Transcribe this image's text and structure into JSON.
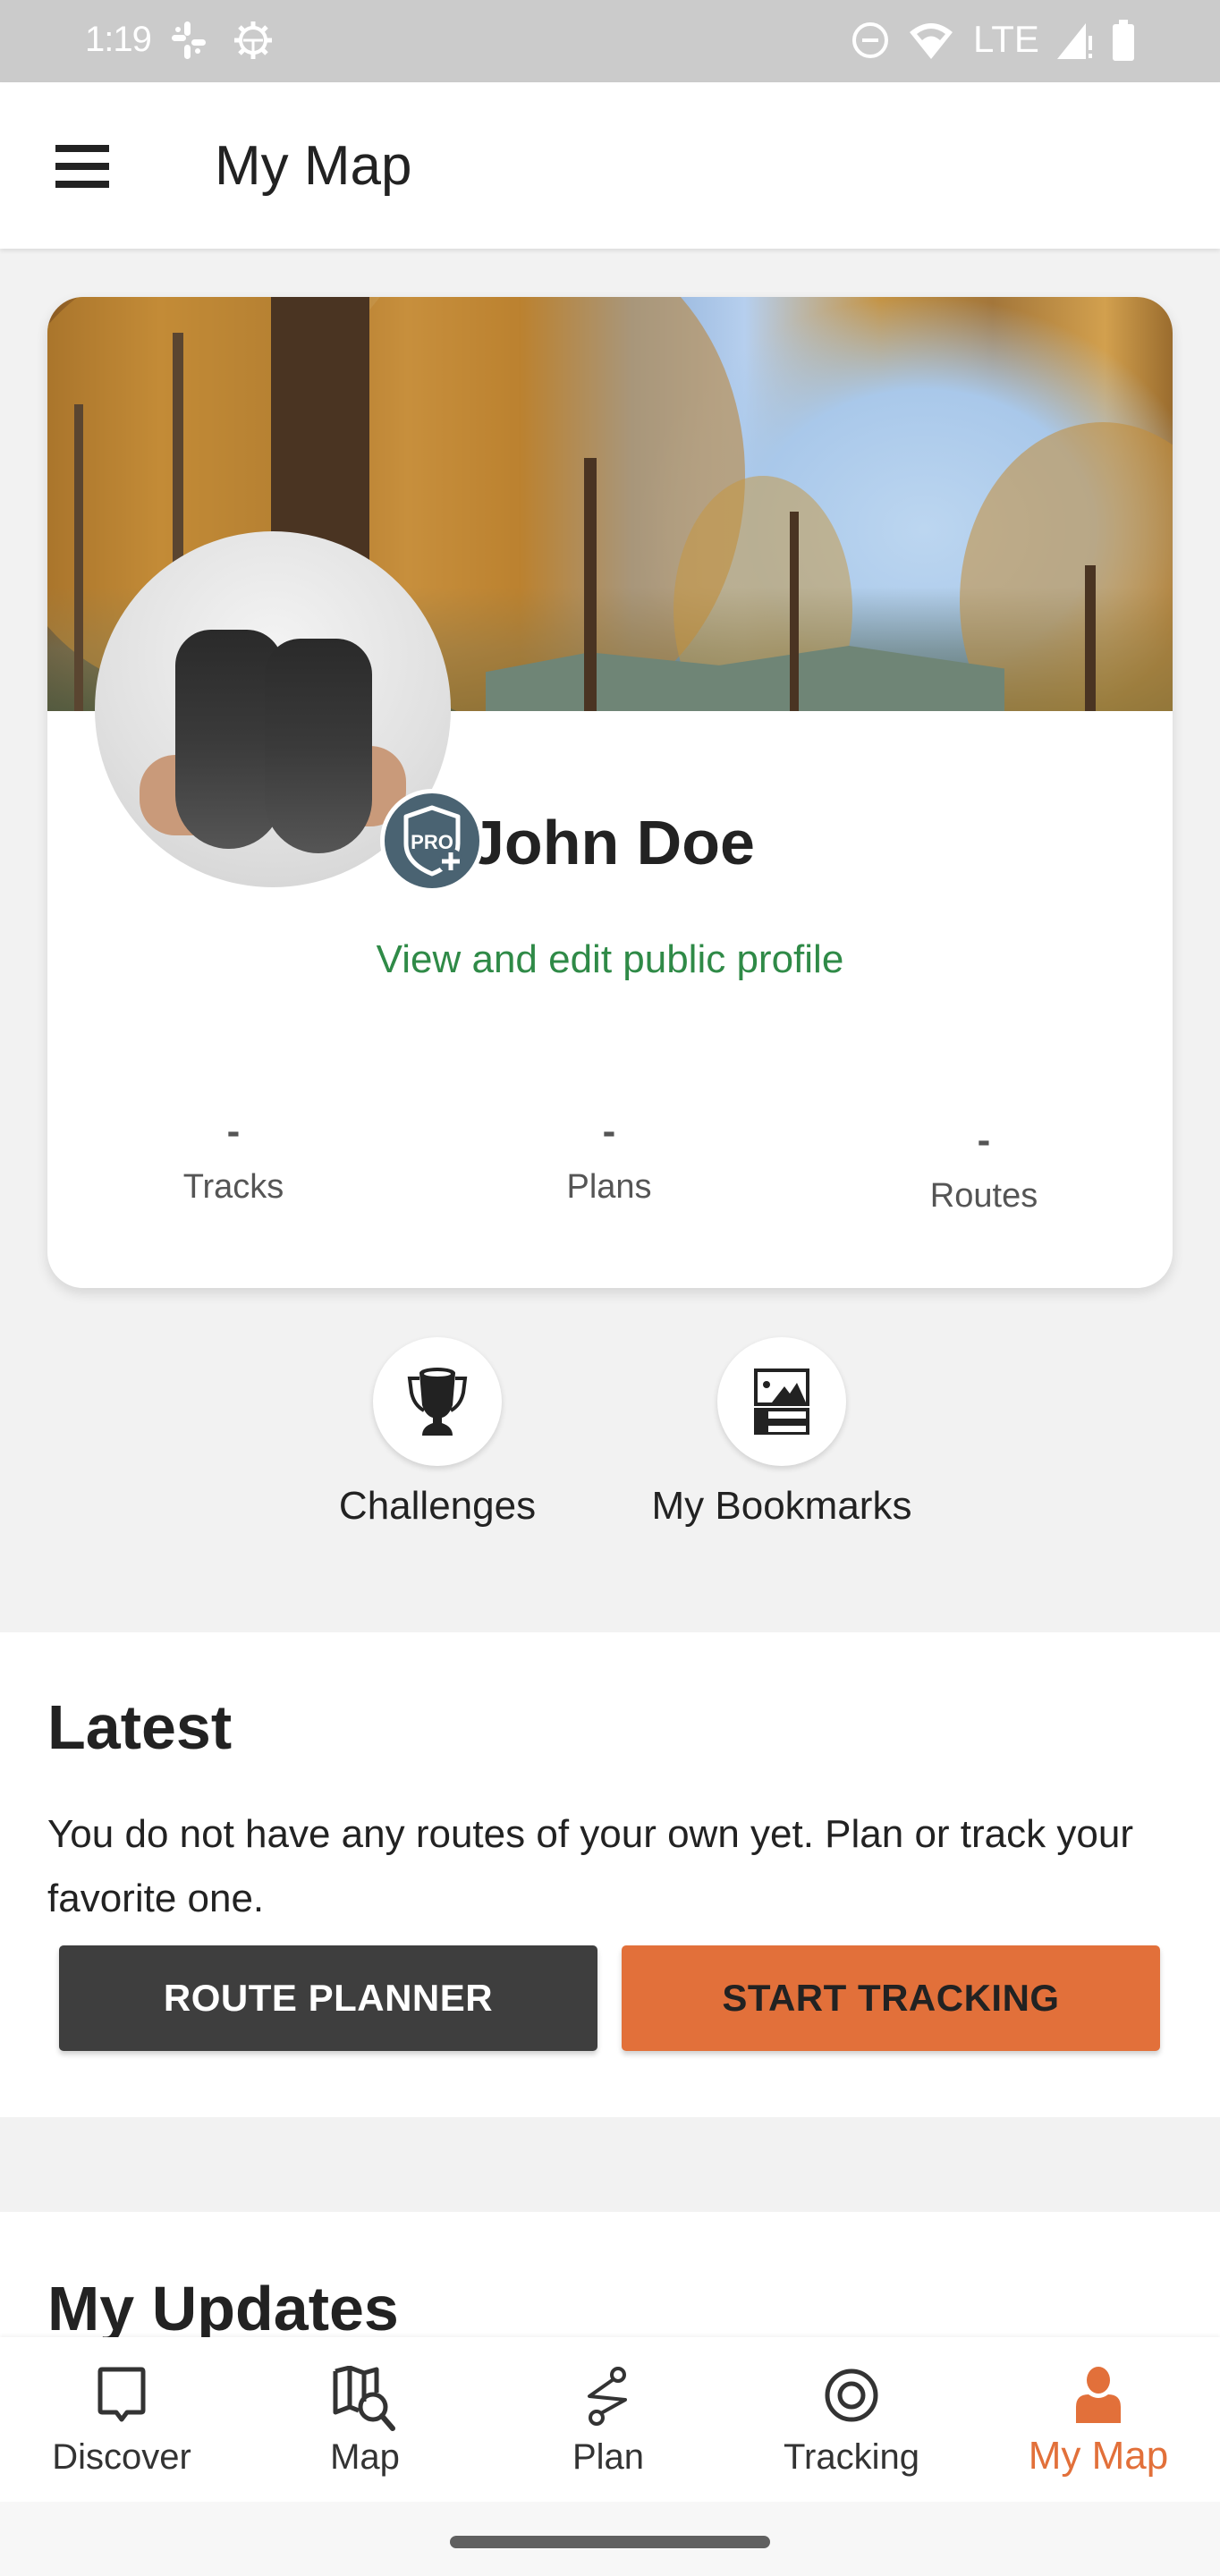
{
  "status_bar": {
    "time": "1:19",
    "left_icons": [
      "slack-icon",
      "settings-gear-icon"
    ],
    "right_icons": [
      "do-not-disturb-icon",
      "wifi-icon",
      "lte-label",
      "signal-icon",
      "battery-icon"
    ],
    "network_label": "LTE"
  },
  "app_bar": {
    "menu_icon": "hamburger-menu-icon",
    "title": "My Map"
  },
  "profile": {
    "name": "John Doe",
    "badge": "PRO+",
    "profile_link": "View and edit public profile",
    "stats": [
      {
        "value": "-",
        "label": "Tracks"
      },
      {
        "value": "-",
        "label": "Plans"
      },
      {
        "value": "-",
        "label": "Routes"
      }
    ]
  },
  "quick_actions": [
    {
      "label": "Challenges",
      "icon": "trophy-icon"
    },
    {
      "label": "My Bookmarks",
      "icon": "bookmarks-icon"
    }
  ],
  "latest": {
    "title": "Latest",
    "message": "You do not have any routes of your own yet. Plan or track your favorite one.",
    "buttons": {
      "route_planner": "ROUTE PLANNER",
      "start_tracking": "START TRACKING"
    }
  },
  "updates": {
    "title": "My Updates"
  },
  "bottom_nav": {
    "active": "My Map",
    "items": [
      {
        "label": "Discover",
        "icon": "discover-bubble-icon"
      },
      {
        "label": "Map",
        "icon": "map-search-icon"
      },
      {
        "label": "Plan",
        "icon": "route-plan-icon"
      },
      {
        "label": "Tracking",
        "icon": "tracking-target-icon"
      },
      {
        "label": "My Map",
        "icon": "person-icon"
      }
    ]
  },
  "colors": {
    "accent_orange": "#e2703a",
    "link_green": "#2f8a47",
    "dark_button": "#3e3e3e",
    "pro_badge": "#4a6372",
    "background": "#f2f2f2"
  }
}
